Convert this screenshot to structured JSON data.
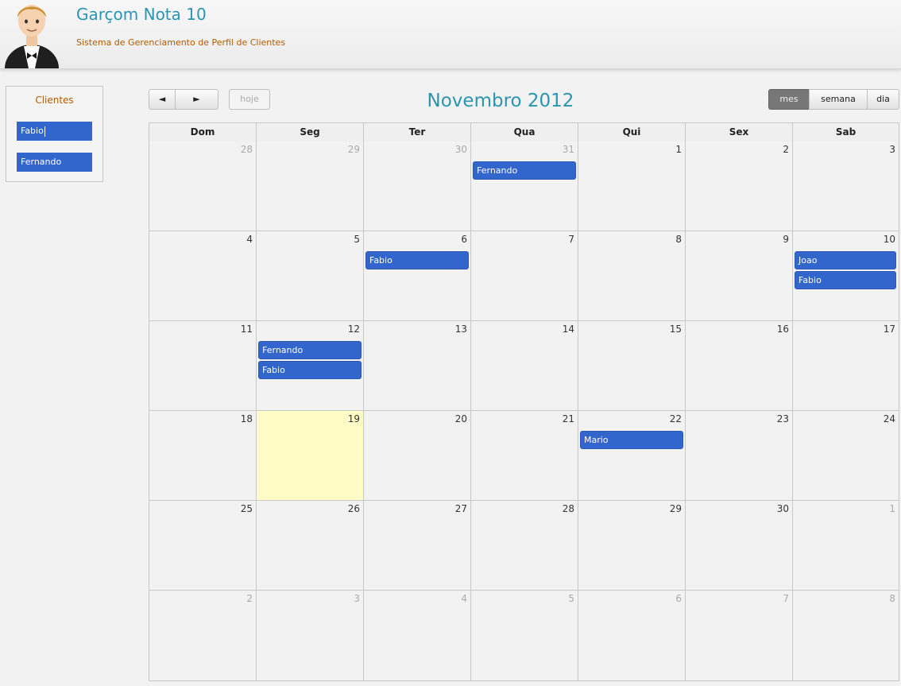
{
  "header": {
    "title": "Garçom Nota 10",
    "subtitle": "Sistema de Gerenciamento de Perfil de Clientes"
  },
  "sidebar": {
    "title": "Clientes",
    "clients": [
      "Fabio",
      "Fernando"
    ]
  },
  "toolbar": {
    "prev_icon": "◄",
    "next_icon": "►",
    "today_label": "hoje",
    "month_label": "mes",
    "week_label": "semana",
    "day_label": "dia",
    "active_view": "mes"
  },
  "calendar": {
    "title": "Novembro 2012",
    "weekdays": [
      "Dom",
      "Seg",
      "Ter",
      "Qua",
      "Qui",
      "Sex",
      "Sab"
    ],
    "today": "19",
    "weeks": [
      [
        {
          "d": "28",
          "o": true
        },
        {
          "d": "29",
          "o": true
        },
        {
          "d": "30",
          "o": true
        },
        {
          "d": "31",
          "o": true,
          "e": [
            "Fernando"
          ]
        },
        {
          "d": "1"
        },
        {
          "d": "2"
        },
        {
          "d": "3"
        }
      ],
      [
        {
          "d": "4"
        },
        {
          "d": "5"
        },
        {
          "d": "6",
          "e": [
            "Fabio"
          ]
        },
        {
          "d": "7"
        },
        {
          "d": "8"
        },
        {
          "d": "9"
        },
        {
          "d": "10",
          "e": [
            "Joao",
            "Fabio"
          ]
        }
      ],
      [
        {
          "d": "11"
        },
        {
          "d": "12",
          "e": [
            "Fernando",
            "Fabio"
          ]
        },
        {
          "d": "13"
        },
        {
          "d": "14"
        },
        {
          "d": "15"
        },
        {
          "d": "16"
        },
        {
          "d": "17"
        }
      ],
      [
        {
          "d": "18"
        },
        {
          "d": "19",
          "t": true
        },
        {
          "d": "20"
        },
        {
          "d": "21"
        },
        {
          "d": "22",
          "e": [
            "Mario"
          ]
        },
        {
          "d": "23"
        },
        {
          "d": "24"
        }
      ],
      [
        {
          "d": "25"
        },
        {
          "d": "26"
        },
        {
          "d": "27"
        },
        {
          "d": "28"
        },
        {
          "d": "29"
        },
        {
          "d": "30"
        },
        {
          "d": "1",
          "o": true
        }
      ],
      [
        {
          "d": "2",
          "o": true
        },
        {
          "d": "3",
          "o": true
        },
        {
          "d": "4",
          "o": true
        },
        {
          "d": "5",
          "o": true
        },
        {
          "d": "6",
          "o": true
        },
        {
          "d": "7",
          "o": true
        },
        {
          "d": "8",
          "o": true
        }
      ]
    ]
  },
  "colors": {
    "title": "#2a95b0",
    "subtitle": "#b35a00",
    "event": "#3366cc",
    "today": "#fffcc8"
  }
}
